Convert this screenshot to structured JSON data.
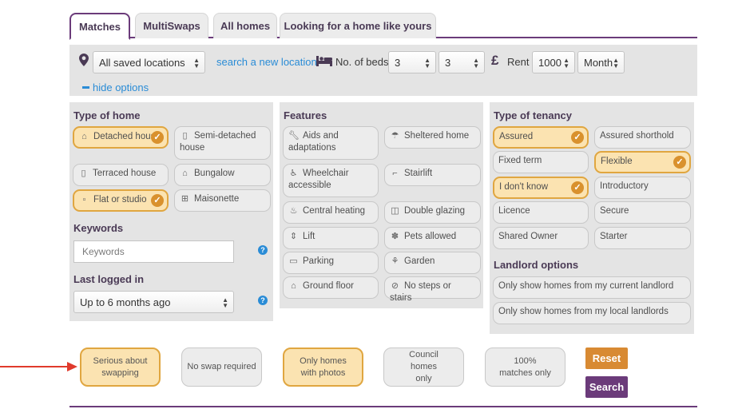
{
  "tabs": [
    {
      "label": "Matches"
    },
    {
      "label": "MultiSwaps"
    },
    {
      "label": "All homes"
    },
    {
      "label": "Looking for a home like yours"
    }
  ],
  "searchbar": {
    "location_value": "All saved locations",
    "search_location_link": "search a new location",
    "beds_label": "No. of beds",
    "beds_min": "3",
    "beds_max": "3",
    "rent_label": "Rent",
    "rent_value": "1000",
    "rent_period": "Month",
    "hide_options": "hide options"
  },
  "type_of_home": {
    "title": "Type of home",
    "options": [
      {
        "label": "Detached house",
        "icon": "house-icon",
        "selected": true
      },
      {
        "label": "Semi-detached house",
        "icon": "semi-detached-icon",
        "selected": false
      },
      {
        "label": "Terraced house",
        "icon": "terraced-icon",
        "selected": false
      },
      {
        "label": "Bungalow",
        "icon": "bungalow-icon",
        "selected": false
      },
      {
        "label": "Flat or studio",
        "icon": "flat-icon",
        "selected": true
      },
      {
        "label": "Maisonette",
        "icon": "maisonette-icon",
        "selected": false
      }
    ]
  },
  "keywords": {
    "title": "Keywords",
    "placeholder": "Keywords"
  },
  "last_logged": {
    "title": "Last logged in",
    "value": "Up to 6 months ago"
  },
  "features": {
    "title": "Features",
    "options": [
      {
        "label": "Aids and adaptations",
        "icon": "wrench-icon"
      },
      {
        "label": "Sheltered home",
        "icon": "umbrella-icon"
      },
      {
        "label": "Wheelchair accessible",
        "icon": "wheelchair-icon"
      },
      {
        "label": "Stairlift",
        "icon": "stairlift-icon"
      },
      {
        "label": "Central heating",
        "icon": "flame-icon"
      },
      {
        "label": "Double glazing",
        "icon": "window-icon"
      },
      {
        "label": "Lift",
        "icon": "lift-icon"
      },
      {
        "label": "Pets allowed",
        "icon": "paw-icon"
      },
      {
        "label": "Parking",
        "icon": "car-icon"
      },
      {
        "label": "Garden",
        "icon": "plant-icon"
      },
      {
        "label": "Ground floor",
        "icon": "ground-floor-icon"
      },
      {
        "label": "No steps or stairs",
        "icon": "no-steps-icon"
      }
    ]
  },
  "tenancy": {
    "title": "Type of tenancy",
    "options": [
      {
        "label": "Assured",
        "selected": true
      },
      {
        "label": "Assured shorthold",
        "selected": false
      },
      {
        "label": "Fixed term",
        "selected": false
      },
      {
        "label": "Flexible",
        "selected": true
      },
      {
        "label": "I don't know",
        "selected": true
      },
      {
        "label": "Introductory",
        "selected": false
      },
      {
        "label": "Licence",
        "selected": false
      },
      {
        "label": "Secure",
        "selected": false
      },
      {
        "label": "Shared Owner",
        "selected": false
      },
      {
        "label": "Starter",
        "selected": false
      }
    ]
  },
  "landlord": {
    "title": "Landlord options",
    "options": [
      {
        "label": "Only show homes from my current landlord"
      },
      {
        "label": "Only show homes from my local landlords"
      }
    ]
  },
  "bottom_filters": [
    {
      "label": "Serious about swapping",
      "selected": true
    },
    {
      "label": "No swap required",
      "selected": false
    },
    {
      "label": "Only homes with photos",
      "selected": true
    },
    {
      "label": "Council homes only",
      "selected": false
    },
    {
      "label": "100% matches only",
      "selected": false
    }
  ],
  "buttons": {
    "reset": "Reset",
    "search": "Search"
  },
  "colors": {
    "brand_purple": "#6b3b7a",
    "accent_orange": "#d88a33",
    "selected_fill": "#fbe3b1",
    "link_blue": "#2a8cd6",
    "annotation_red": "#e03a2c"
  }
}
